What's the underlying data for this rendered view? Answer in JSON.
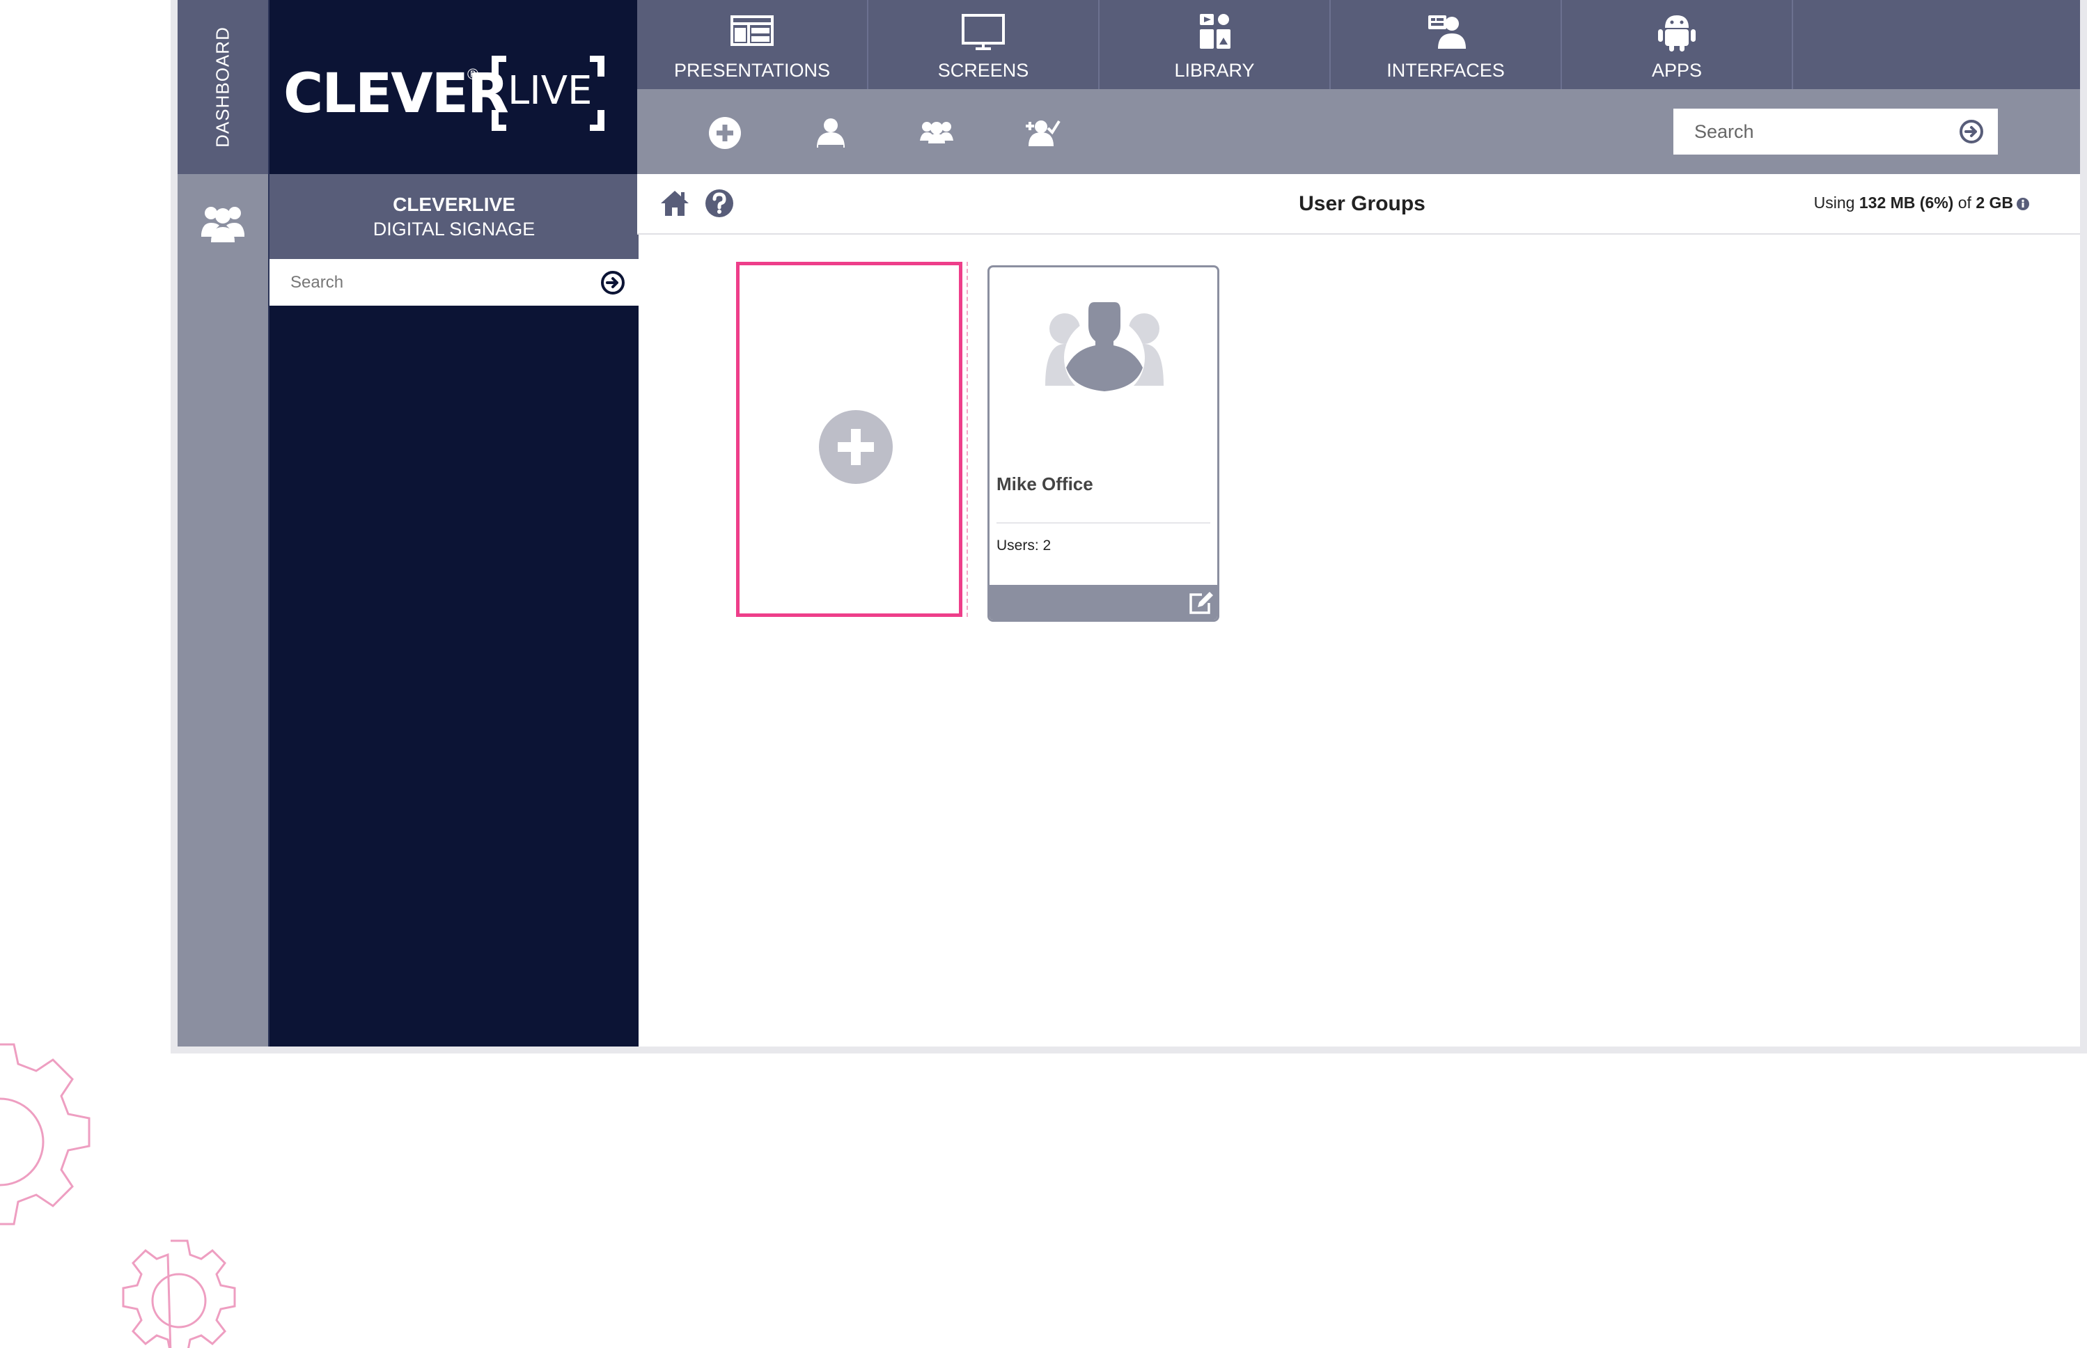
{
  "app": {
    "dashboard_label": "DASHBOARD",
    "brand_primary": "#585d79",
    "brand_dark": "#0c1435",
    "brand_gray": "#8b8fa0",
    "accent": "#ee3e8a"
  },
  "logo": {
    "word": "CLEVER",
    "reg_mark": "®",
    "live": "LIVE"
  },
  "sidebar": {
    "title_line1": "CLEVERLIVE",
    "title_line2": "DIGITAL SIGNAGE",
    "search_placeholder": "Search",
    "search_icon": "arrow-right-circle-icon",
    "users_icon": "users-icon"
  },
  "nav": [
    {
      "label": "PRESENTATIONS",
      "icon": "presentation-icon"
    },
    {
      "label": "SCREENS",
      "icon": "monitor-icon"
    },
    {
      "label": "LIBRARY",
      "icon": "media-library-icon"
    },
    {
      "label": "INTERFACES",
      "icon": "interface-user-icon"
    },
    {
      "label": "APPS",
      "icon": "android-icon"
    }
  ],
  "toolbar": {
    "buttons": [
      "add-circle-icon",
      "user-icon",
      "user-group-icon",
      "user-add-icon"
    ],
    "search_placeholder": "Search"
  },
  "header": {
    "page_title": "User Groups",
    "usage_prefix": "Using ",
    "usage_amount": "132 MB (6%)",
    "usage_mid": " of ",
    "usage_total": "2 GB"
  },
  "cards": {
    "add_card_icon": "plus-circle-icon",
    "groups": [
      {
        "name": "Mike Office",
        "users_label": "Users: ",
        "users_count": "2"
      }
    ]
  }
}
